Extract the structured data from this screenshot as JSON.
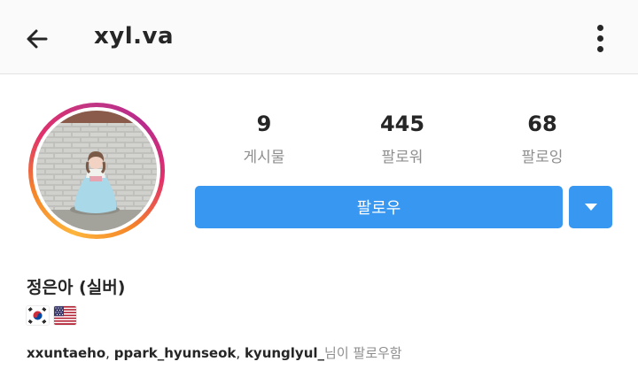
{
  "header": {
    "username": "xyl.va",
    "back_icon": "arrow-left-icon",
    "more_icon": "more-vertical-icon"
  },
  "profile": {
    "avatar_icon": "profile-photo",
    "stats": [
      {
        "value": "9",
        "label": "게시물"
      },
      {
        "value": "445",
        "label": "팔로워"
      },
      {
        "value": "68",
        "label": "팔로잉"
      }
    ],
    "follow_label": "팔로우",
    "dropdown_icon": "caret-down-icon",
    "display_name": "정은아 (실버)",
    "bio_flags": [
      "korea-flag-icon",
      "usa-flag-icon"
    ],
    "followed_by": {
      "users": [
        "xxuntaeho",
        "ppark_hyunseok",
        "kyunglyul_"
      ],
      "separator": ", ",
      "suffix": "님이 팔로우함"
    }
  },
  "colors": {
    "accent": "#3897f0",
    "text": "#262626",
    "muted": "#8e8e8e",
    "topbar_bg": "#fafafa"
  }
}
